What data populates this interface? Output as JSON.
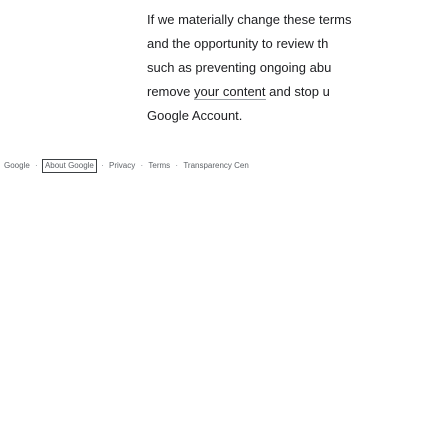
{
  "body_text": {
    "line1": "If we materially change these terms",
    "line2": "and the opportunity to review th",
    "line3": "such as preventing ongoing abu",
    "line4_prefix": "remove ",
    "line4_link": "your content",
    "line4_suffix": " and stop u",
    "line5": "Google Account."
  },
  "footer": {
    "items": [
      "Google",
      "About Google",
      "Privacy",
      "Terms",
      "Transparency Cen"
    ],
    "separator": "·"
  }
}
